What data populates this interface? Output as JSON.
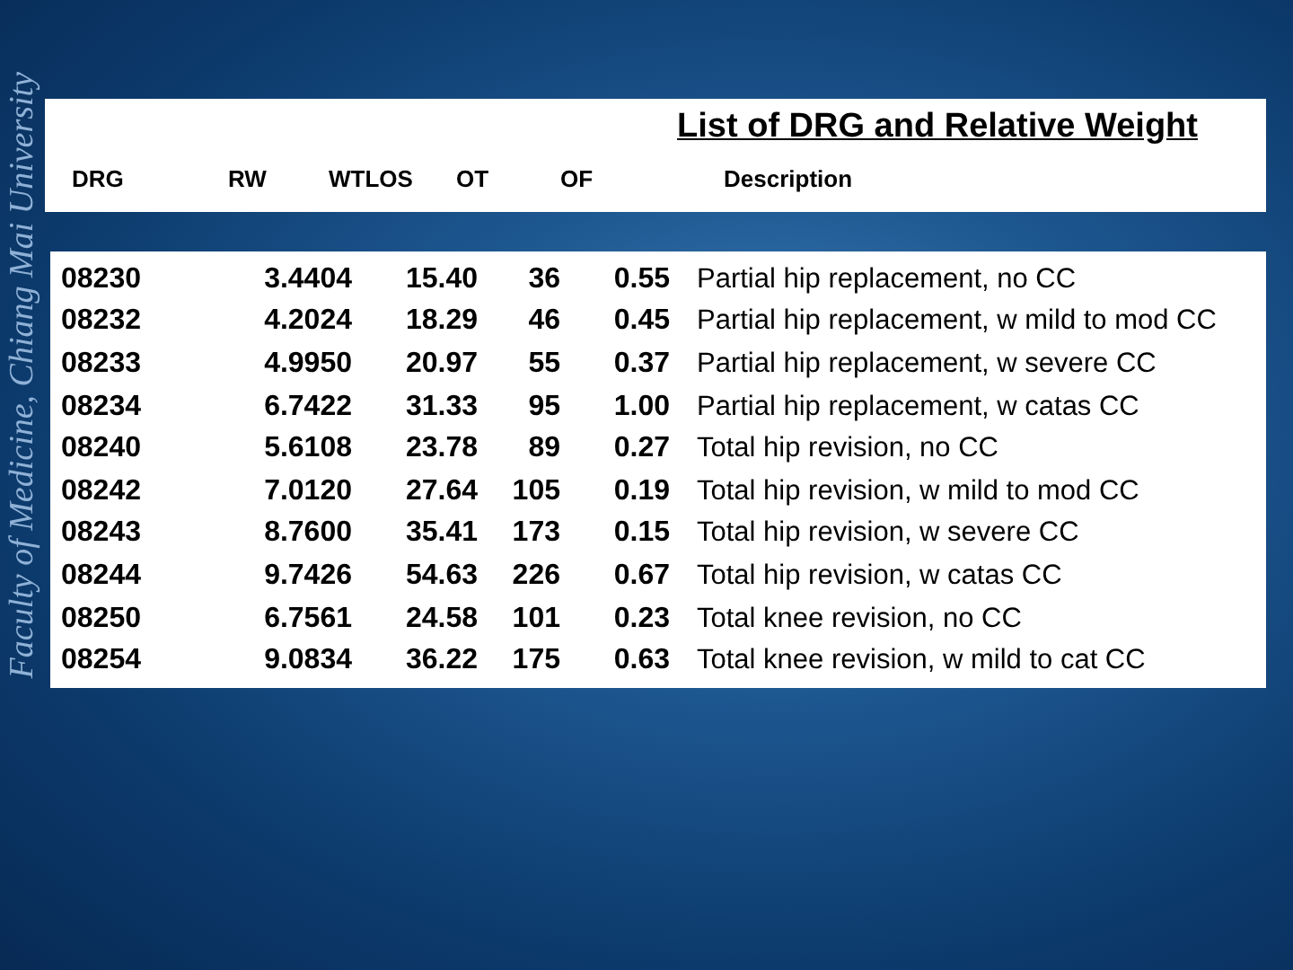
{
  "side_text": "Faculty of Medicine, Chiang Mai University",
  "title": "List of DRG and Relative Weight",
  "columns": [
    "DRG",
    "RW",
    "WTLOS",
    "OT",
    "OF",
    "Description"
  ],
  "rows": [
    [
      "08230",
      "3.4404",
      "15.40",
      "36",
      "0.55",
      "Partial hip replacement, no CC"
    ],
    [
      "08232",
      "4.2024",
      "18.29",
      "46",
      "0.45",
      "Partial hip replacement, w mild to mod CC"
    ],
    [
      "08233",
      "4.9950",
      "20.97",
      "55",
      "0.37",
      "Partial hip replacement, w severe CC"
    ],
    [
      "08234",
      "6.7422",
      "31.33",
      "95",
      "1.00",
      "Partial hip replacement, w catas CC"
    ],
    [
      "08240",
      "5.6108",
      "23.78",
      "89",
      "0.27",
      "Total hip revision, no CC"
    ],
    [
      "08242",
      "7.0120",
      "27.64",
      "105",
      "0.19",
      "Total hip revision, w mild to mod CC"
    ],
    [
      "08243",
      "8.7600",
      "35.41",
      "173",
      "0.15",
      "Total hip revision, w severe CC"
    ],
    [
      "08244",
      "9.7426",
      "54.63",
      "226",
      "0.67",
      "Total hip revision, w catas CC"
    ],
    [
      "08250",
      "6.7561",
      "24.58",
      "101",
      "0.23",
      "Total knee revision, no CC"
    ],
    [
      "08254",
      "9.0834",
      "36.22",
      "175",
      "0.63",
      "Total knee revision, w mild to cat CC"
    ]
  ]
}
